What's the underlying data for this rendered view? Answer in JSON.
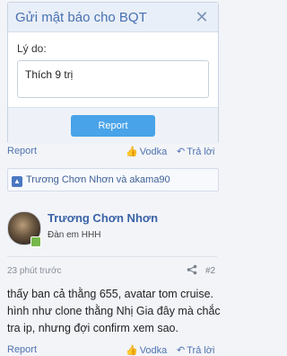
{
  "dialog": {
    "title": "Gửi mật báo cho BQT",
    "close_glyph": "✕",
    "reason_label": "Lý do:",
    "reason_value": "Thích 9 trị",
    "submit_label": "Report"
  },
  "prev_post_actions": {
    "report": "Report",
    "like": "Vodka",
    "reply": "Trả lời"
  },
  "likes_bar": {
    "text": "Trương Chơn Nhơn và akama90"
  },
  "post": {
    "username": "Trương Chơn Nhơn",
    "user_title": "Đàn em HHH",
    "time": "23 phút trước",
    "post_number": "#2",
    "message": "thấy ban cả thằng 655, avatar tom cruise. hình như clone thằng Nhị Gia đây mà chắc tra ip, nhưng đợi confirm xem sao.",
    "actions": {
      "report": "Report",
      "like": "Vodka",
      "reply": "Trả lời"
    }
  },
  "colors": {
    "accent": "#4770b0",
    "button": "#49a3e8",
    "background": "#f2f4f8"
  }
}
